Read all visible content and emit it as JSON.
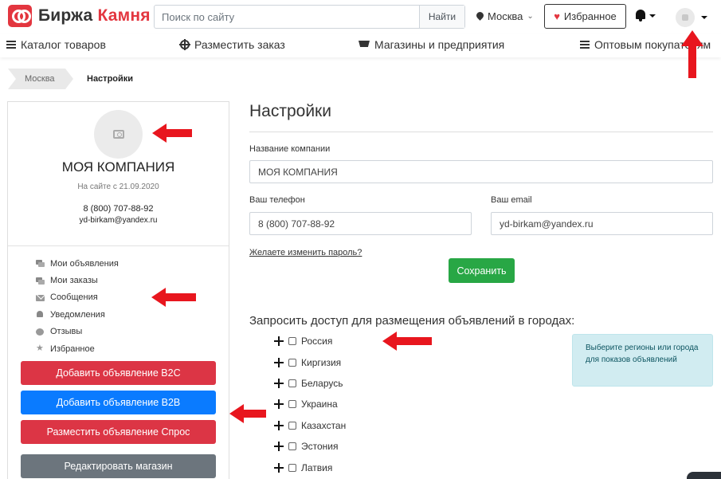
{
  "header": {
    "logo_main": "Биржа",
    "logo_accent": "Камня",
    "search_placeholder": "Поиск по сайту",
    "search_button": "Найти",
    "city": "Москва",
    "favorites_label": "Избранное"
  },
  "nav": {
    "catalog": "Каталог товаров",
    "place_order": "Разместить заказ",
    "shops": "Магазины и предприятия",
    "wholesale": "Оптовым покупателям"
  },
  "breadcrumb": {
    "home": "Москва",
    "current": "Настройки"
  },
  "profile": {
    "company_name": "МОЯ КОМПАНИЯ",
    "since": "На сайте с 21.09.2020",
    "phone": "8 (800) 707-88-92",
    "email": "yd-birkam@yandex.ru",
    "menu": [
      {
        "label": "Мои объявления",
        "icon": "chat-icon"
      },
      {
        "label": "Мои заказы",
        "icon": "chat-icon"
      },
      {
        "label": "Сообщения",
        "icon": "mail-icon"
      },
      {
        "label": "Уведомления",
        "icon": "bell-icon"
      },
      {
        "label": "Отзывы",
        "icon": "comment-icon"
      },
      {
        "label": "Избранное",
        "icon": "star-icon"
      }
    ],
    "buttons": {
      "add_b2c": "Добавить объявление B2C",
      "add_b2b": "Добавить объявление B2B",
      "add_demand": "Разместить объявление Спрос",
      "edit_shop": "Редактировать магазин"
    }
  },
  "settings": {
    "title": "Настройки",
    "company_label": "Название компании",
    "company_value": "МОЯ КОМПАНИЯ",
    "phone_label": "Ваш телефон",
    "phone_value": "8 (800) 707-88-92",
    "email_label": "Ваш email",
    "email_value": "yd-birkam@yandex.ru",
    "change_password": "Желаете изменить пароль?",
    "save": "Сохранить"
  },
  "access": {
    "title": "Запросить доступ для размещения объявлений в городах:",
    "countries": [
      "Россия",
      "Киргизия",
      "Беларусь",
      "Украина",
      "Казахстан",
      "Эстония",
      "Латвия"
    ],
    "info": "Выберите регионы или города для показов объявлений"
  },
  "colors": {
    "brand_red": "#e3363f",
    "danger": "#dc3545",
    "primary": "#0a7bff",
    "success": "#28a745",
    "secondary": "#6c757d",
    "info_bg": "#d1ecf1",
    "annotation_arrow": "#e8161e"
  }
}
